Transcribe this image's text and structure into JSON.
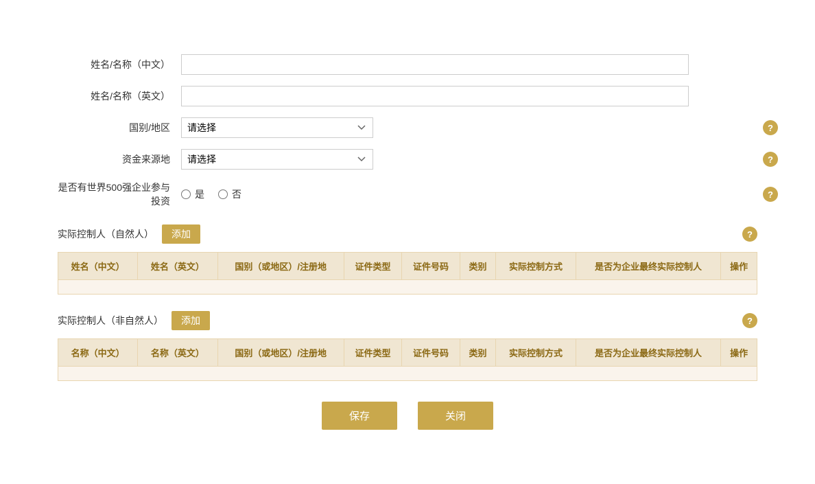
{
  "form": {
    "name_chinese_label": "姓名/名称（中文）",
    "name_english_label": "姓名/名称（英文）",
    "country_label": "国别/地区",
    "country_placeholder": "请选择",
    "fund_source_label": "资金来源地",
    "fund_source_placeholder": "请选择",
    "fortune500_label": "是否有世界500强企业参与投资",
    "fortune500_yes": "是",
    "fortune500_no": "否"
  },
  "natural_person_section": {
    "title": "实际控制人（自然人）",
    "add_button": "添加",
    "columns": [
      "姓名（中文）",
      "姓名（英文）",
      "国别（或地区）/注册地",
      "证件类型",
      "证件号码",
      "类别",
      "实际控制方式",
      "是否为企业最终实际控制人",
      "操作"
    ]
  },
  "non_natural_person_section": {
    "title": "实际控制人（非自然人）",
    "add_button": "添加",
    "columns": [
      "名称（中文）",
      "名称（英文）",
      "国别（或地区）/注册地",
      "证件类型",
      "证件号码",
      "类别",
      "实际控制方式",
      "是否为企业最终实际控制人",
      "操作"
    ]
  },
  "buttons": {
    "save": "保存",
    "close": "关闭"
  },
  "help_icon_text": "?"
}
